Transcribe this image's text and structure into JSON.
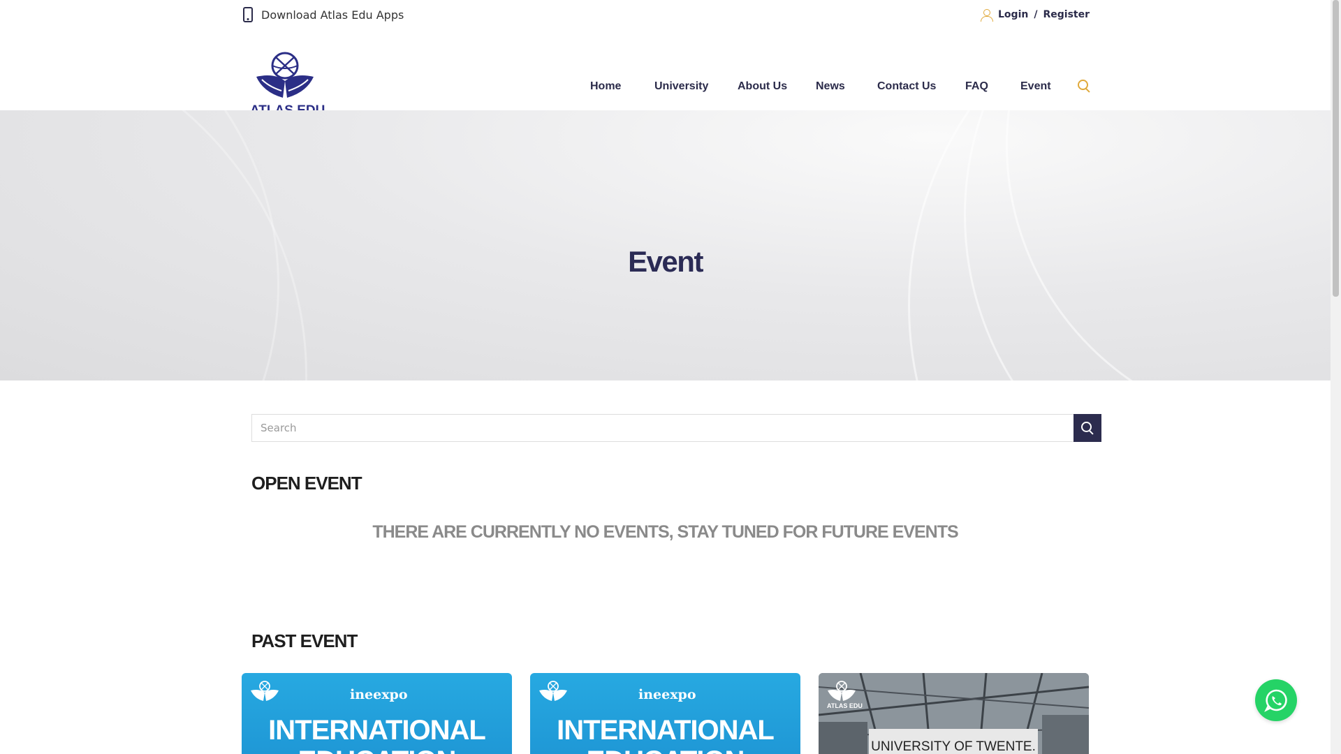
{
  "topbar": {
    "download_label": "Download Atlas Edu Apps",
    "login_label": "Login",
    "separator": "/",
    "register_label": "Register"
  },
  "header": {
    "logo_text": "ATLAS EDU",
    "brand_color": "#2b2e86",
    "accent_color": "#e0a93a"
  },
  "nav": {
    "items": [
      "Home",
      "University",
      "About Us",
      "News",
      "Contact Us",
      "FAQ",
      "Event"
    ]
  },
  "hero": {
    "title": "Event"
  },
  "search": {
    "placeholder": "Search",
    "value": ""
  },
  "open_event": {
    "heading": "OPEN EVENT",
    "empty_message": "THERE ARE CURRENTLY NO EVENTS, STAY TUNED FOR FUTURE EVENTS"
  },
  "past_event": {
    "heading": "PAST EVENT",
    "cards": [
      {
        "brand": "ineexpo",
        "title_line1": "INTERNATIONAL",
        "title_line2": "EDUCATION"
      },
      {
        "brand": "ineexpo",
        "title_line1": "INTERNATIONAL",
        "title_line2": "EDUCATION"
      },
      {
        "logo_caption": "ATLAS EDU",
        "banner": "UNIVERSITY OF TWENTE."
      }
    ]
  }
}
